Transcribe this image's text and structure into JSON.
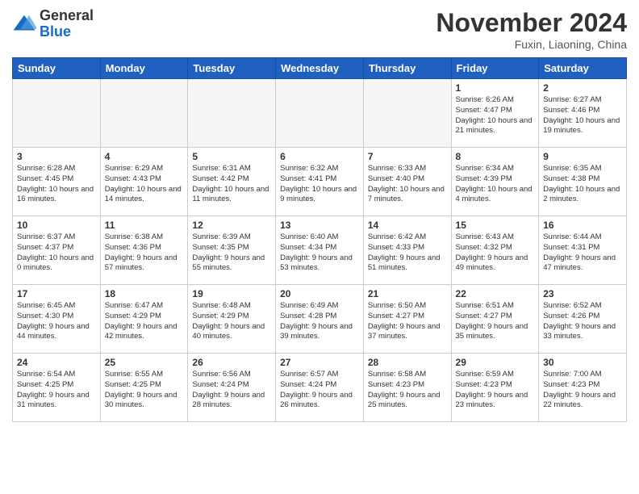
{
  "header": {
    "logo_general": "General",
    "logo_blue": "Blue",
    "month_title": "November 2024",
    "location": "Fuxin, Liaoning, China"
  },
  "days_of_week": [
    "Sunday",
    "Monday",
    "Tuesday",
    "Wednesday",
    "Thursday",
    "Friday",
    "Saturday"
  ],
  "weeks": [
    [
      {
        "day": "",
        "info": ""
      },
      {
        "day": "",
        "info": ""
      },
      {
        "day": "",
        "info": ""
      },
      {
        "day": "",
        "info": ""
      },
      {
        "day": "",
        "info": ""
      },
      {
        "day": "1",
        "info": "Sunrise: 6:26 AM\nSunset: 4:47 PM\nDaylight: 10 hours and 21 minutes."
      },
      {
        "day": "2",
        "info": "Sunrise: 6:27 AM\nSunset: 4:46 PM\nDaylight: 10 hours and 19 minutes."
      }
    ],
    [
      {
        "day": "3",
        "info": "Sunrise: 6:28 AM\nSunset: 4:45 PM\nDaylight: 10 hours and 16 minutes."
      },
      {
        "day": "4",
        "info": "Sunrise: 6:29 AM\nSunset: 4:43 PM\nDaylight: 10 hours and 14 minutes."
      },
      {
        "day": "5",
        "info": "Sunrise: 6:31 AM\nSunset: 4:42 PM\nDaylight: 10 hours and 11 minutes."
      },
      {
        "day": "6",
        "info": "Sunrise: 6:32 AM\nSunset: 4:41 PM\nDaylight: 10 hours and 9 minutes."
      },
      {
        "day": "7",
        "info": "Sunrise: 6:33 AM\nSunset: 4:40 PM\nDaylight: 10 hours and 7 minutes."
      },
      {
        "day": "8",
        "info": "Sunrise: 6:34 AM\nSunset: 4:39 PM\nDaylight: 10 hours and 4 minutes."
      },
      {
        "day": "9",
        "info": "Sunrise: 6:35 AM\nSunset: 4:38 PM\nDaylight: 10 hours and 2 minutes."
      }
    ],
    [
      {
        "day": "10",
        "info": "Sunrise: 6:37 AM\nSunset: 4:37 PM\nDaylight: 10 hours and 0 minutes."
      },
      {
        "day": "11",
        "info": "Sunrise: 6:38 AM\nSunset: 4:36 PM\nDaylight: 9 hours and 57 minutes."
      },
      {
        "day": "12",
        "info": "Sunrise: 6:39 AM\nSunset: 4:35 PM\nDaylight: 9 hours and 55 minutes."
      },
      {
        "day": "13",
        "info": "Sunrise: 6:40 AM\nSunset: 4:34 PM\nDaylight: 9 hours and 53 minutes."
      },
      {
        "day": "14",
        "info": "Sunrise: 6:42 AM\nSunset: 4:33 PM\nDaylight: 9 hours and 51 minutes."
      },
      {
        "day": "15",
        "info": "Sunrise: 6:43 AM\nSunset: 4:32 PM\nDaylight: 9 hours and 49 minutes."
      },
      {
        "day": "16",
        "info": "Sunrise: 6:44 AM\nSunset: 4:31 PM\nDaylight: 9 hours and 47 minutes."
      }
    ],
    [
      {
        "day": "17",
        "info": "Sunrise: 6:45 AM\nSunset: 4:30 PM\nDaylight: 9 hours and 44 minutes."
      },
      {
        "day": "18",
        "info": "Sunrise: 6:47 AM\nSunset: 4:29 PM\nDaylight: 9 hours and 42 minutes."
      },
      {
        "day": "19",
        "info": "Sunrise: 6:48 AM\nSunset: 4:29 PM\nDaylight: 9 hours and 40 minutes."
      },
      {
        "day": "20",
        "info": "Sunrise: 6:49 AM\nSunset: 4:28 PM\nDaylight: 9 hours and 39 minutes."
      },
      {
        "day": "21",
        "info": "Sunrise: 6:50 AM\nSunset: 4:27 PM\nDaylight: 9 hours and 37 minutes."
      },
      {
        "day": "22",
        "info": "Sunrise: 6:51 AM\nSunset: 4:27 PM\nDaylight: 9 hours and 35 minutes."
      },
      {
        "day": "23",
        "info": "Sunrise: 6:52 AM\nSunset: 4:26 PM\nDaylight: 9 hours and 33 minutes."
      }
    ],
    [
      {
        "day": "24",
        "info": "Sunrise: 6:54 AM\nSunset: 4:25 PM\nDaylight: 9 hours and 31 minutes."
      },
      {
        "day": "25",
        "info": "Sunrise: 6:55 AM\nSunset: 4:25 PM\nDaylight: 9 hours and 30 minutes."
      },
      {
        "day": "26",
        "info": "Sunrise: 6:56 AM\nSunset: 4:24 PM\nDaylight: 9 hours and 28 minutes."
      },
      {
        "day": "27",
        "info": "Sunrise: 6:57 AM\nSunset: 4:24 PM\nDaylight: 9 hours and 26 minutes."
      },
      {
        "day": "28",
        "info": "Sunrise: 6:58 AM\nSunset: 4:23 PM\nDaylight: 9 hours and 25 minutes."
      },
      {
        "day": "29",
        "info": "Sunrise: 6:59 AM\nSunset: 4:23 PM\nDaylight: 9 hours and 23 minutes."
      },
      {
        "day": "30",
        "info": "Sunrise: 7:00 AM\nSunset: 4:23 PM\nDaylight: 9 hours and 22 minutes."
      }
    ]
  ]
}
